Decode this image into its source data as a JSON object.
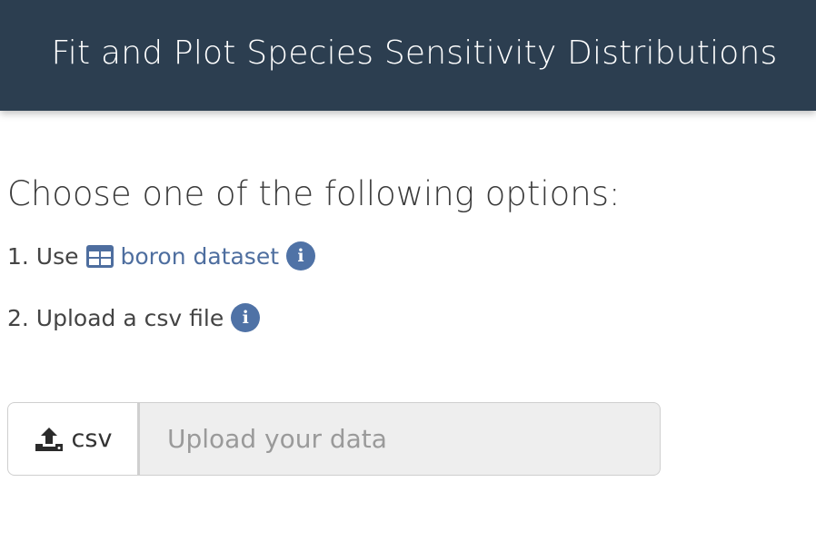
{
  "header": {
    "title": "Fit and Plot Species Sensitivity Distributions"
  },
  "main": {
    "heading": "Choose one of the following options:",
    "options": [
      {
        "number": "1. Use",
        "link_label": "boron dataset",
        "icon": "table-icon",
        "info_icon": "info-icon"
      },
      {
        "number": "2. Upload a csv file",
        "info_icon": "info-icon"
      }
    ],
    "upload": {
      "button_label": "csv",
      "button_icon": "upload-icon",
      "placeholder": "Upload your data"
    }
  },
  "colors": {
    "navbar": "#2c3e50",
    "link": "#4e6e9f",
    "info_icon": "#4f72a6",
    "upload_field": "#eeeeee"
  }
}
